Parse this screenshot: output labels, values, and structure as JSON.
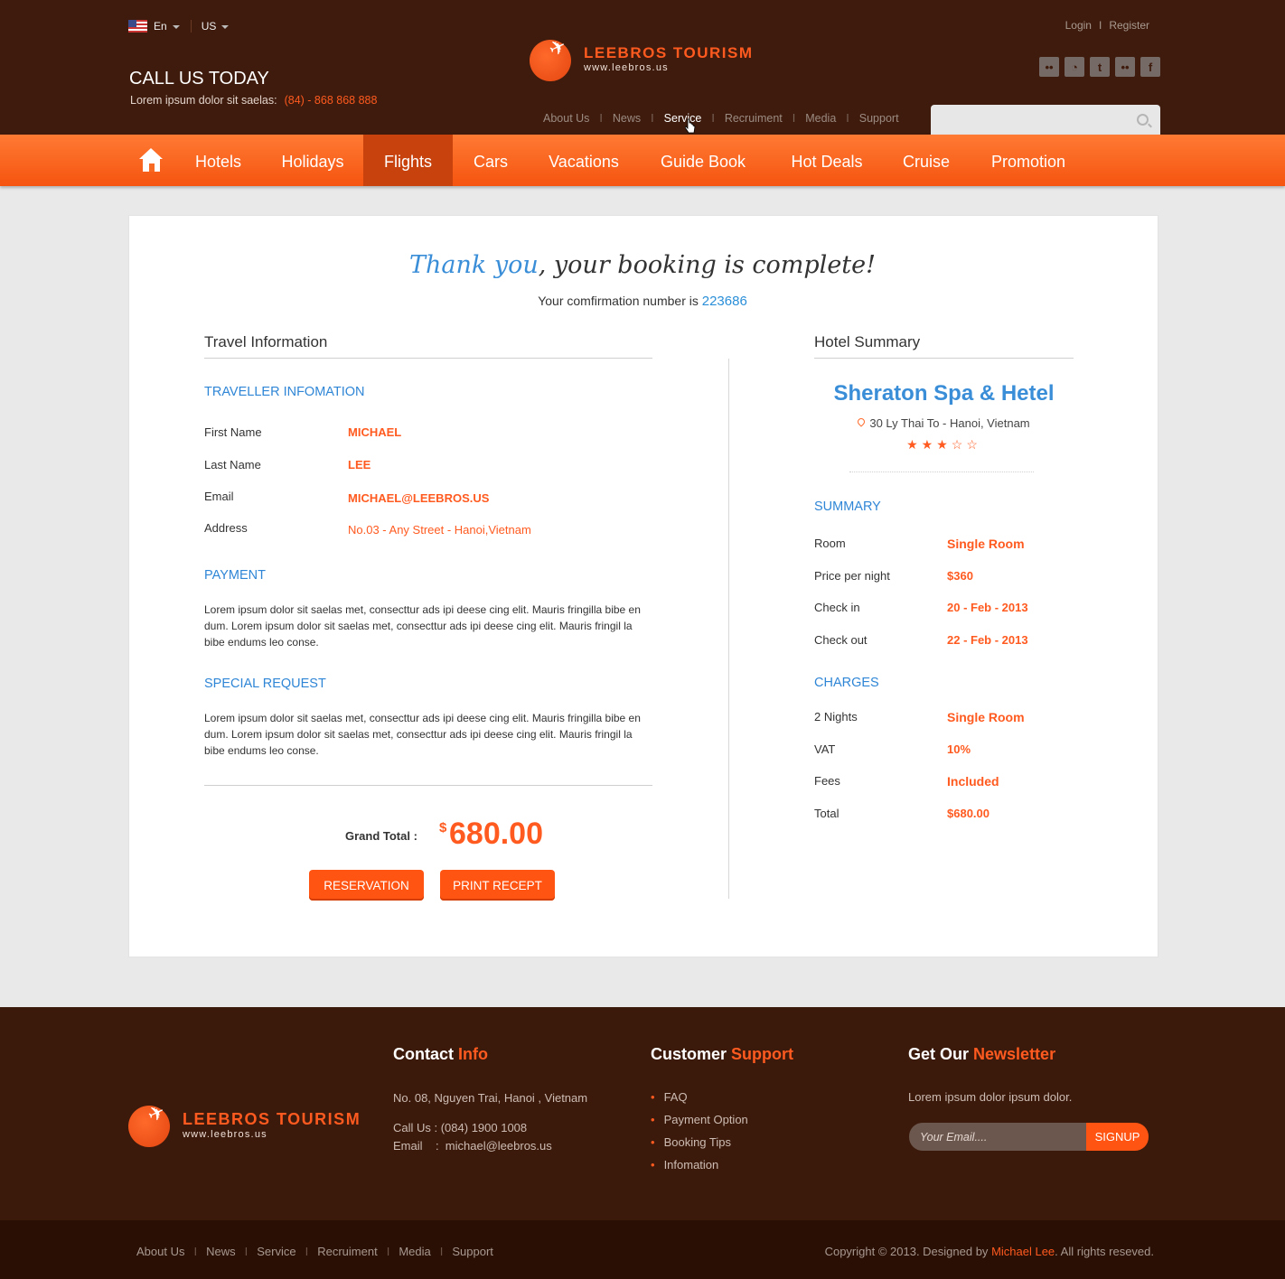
{
  "header": {
    "language": "En",
    "region": "US",
    "call_title": "CALL US TODAY",
    "call_sub": "Lorem ipsum dolor sit saelas:",
    "phone": "(84) - 868 868 888",
    "login": "Login",
    "register": "Register",
    "auth_sep": "I",
    "brand_name": "LEEBROS TOURISM",
    "brand_url": "www.leebros.us",
    "social": [
      "flickr-icon",
      "rss-icon",
      "twitter-icon",
      "flickr-icon",
      "facebook-icon"
    ],
    "topnav": [
      "About Us",
      "News",
      "Service",
      "Recruiment",
      "Media",
      "Support"
    ],
    "topnav_active": "Service",
    "search_placeholder": ""
  },
  "mainnav": {
    "items": [
      "Hotels",
      "Holidays",
      "Flights",
      "Cars",
      "Vacations",
      "Guide Book",
      "Hot Deals",
      "Cruise",
      "Promotion"
    ],
    "active": "Flights"
  },
  "booking": {
    "thanks_accent": "Thank you",
    "thanks_rest": ", your booking is complete!",
    "confirm_text": "Your comfirmation number is",
    "confirm_number": "223686"
  },
  "travel": {
    "heading": "Travel Information",
    "traveller_heading": "TRAVELLER INFOMATION",
    "fields": [
      {
        "label": "First Name",
        "value": "MICHAEL"
      },
      {
        "label": "Last Name",
        "value": "LEE"
      },
      {
        "label": "Email",
        "value": "MICHAEL@LEEBROS.US"
      },
      {
        "label": "Address",
        "value": "No.03 - Any Street - Hanoi,Vietnam"
      }
    ],
    "payment_heading": "PAYMENT",
    "payment_text": "Lorem ipsum dolor sit saelas met, consecttur ads ipi deese cing elit. Mauris fringilla bibe en dum. Lorem ipsum dolor sit saelas met, consecttur ads ipi deese cing elit. Mauris fringil la bibe endums leo conse.",
    "request_heading": "SPECIAL REQUEST",
    "request_text": "Lorem ipsum dolor sit saelas met, consecttur ads ipi deese cing elit. Mauris fringilla bibe en dum. Lorem ipsum dolor sit saelas met, consecttur ads ipi deese cing elit. Mauris fringil la bibe endums leo conse.",
    "grand_label": "Grand Total :",
    "grand_currency": "$",
    "grand_value": "680.00",
    "reservation_label": "RESERVATION",
    "print_label": "PRINT RECEPT"
  },
  "hotel": {
    "heading": "Hotel Summary",
    "name": "Sheraton Spa & Hetel",
    "address": "30 Ly Thai To - Hanoi, Vietnam",
    "rating": 3,
    "rating_max": 5,
    "summary_heading": "SUMMARY",
    "summary": [
      {
        "label": "Room",
        "value": "Single Room"
      },
      {
        "label": "Price per night",
        "value": "$360"
      },
      {
        "label": "Check in",
        "value": "20 - Feb - 2013"
      },
      {
        "label": "Check out",
        "value": "22 - Feb - 2013"
      }
    ],
    "charges_heading": "CHARGES",
    "charges": [
      {
        "label": "2 Nights",
        "value": "Single Room"
      },
      {
        "label": "VAT",
        "value": "10%"
      },
      {
        "label": "Fees",
        "value": "Included"
      },
      {
        "label": "Total",
        "value": "$680.00"
      }
    ]
  },
  "footer": {
    "contact_h1": "Contact",
    "contact_h2": "Info",
    "contact_address": "No. 08, Nguyen Trai, Hanoi , Vietnam",
    "contact_call": "Call Us : (084) 1900 1008",
    "contact_email": "Email    :  michael@leebros.us",
    "support_h1": "Customer",
    "support_h2": "Support",
    "support_links": [
      "FAQ",
      "Payment Option",
      "Booking Tips",
      "Infomation"
    ],
    "news_h1": "Get Our",
    "news_h2": "Newsletter",
    "news_text": "Lorem ipsum dolor ipsum dolor.",
    "email_placeholder": "Your Email....",
    "signup_label": "SIGNUP",
    "bottom_links": [
      "About Us",
      "News",
      "Service",
      "Recruiment",
      "Media",
      "Support"
    ],
    "copyright_pre": "Copyright © 2013. Designed by",
    "designer": "Michael Lee",
    "copyright_post": ". All rights reseved."
  },
  "colors": {
    "brand_orange": "#ff5a1f",
    "header_brown": "#3e1b0c",
    "accent_blue": "#3a8ed8"
  }
}
